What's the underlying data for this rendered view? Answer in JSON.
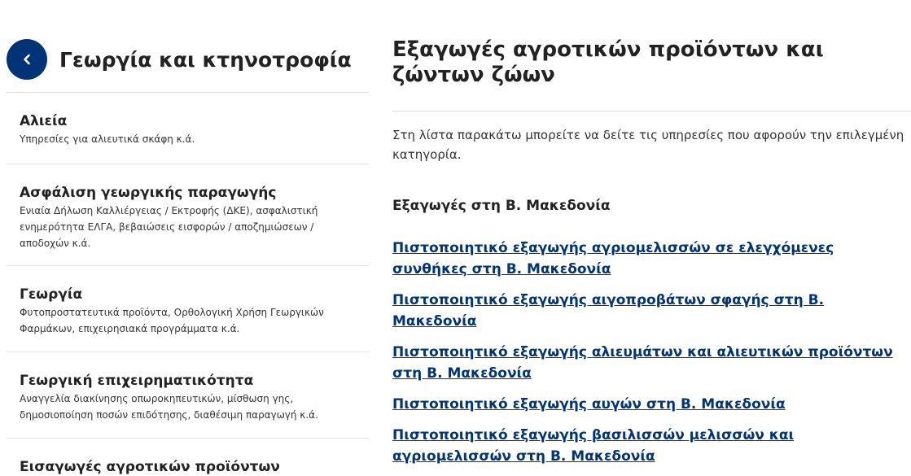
{
  "sidebar": {
    "back_icon": "chevron-left-icon",
    "title": "Γεωργία και κτηνοτροφία",
    "items": [
      {
        "title": "Αλιεία",
        "description": "Υπηρεσίες για αλιευτικά σκάφη κ.ά."
      },
      {
        "title": "Ασφάλιση γεωργικής παραγωγής",
        "description": "Ενιαία Δήλωση Καλλιέργειας / Εκτροφής (ΔΚΕ), ασφαλιστική ενημερότητα ΕΛΓΑ, βεβαιώσεις εισφορών / αποζημιώσεων / αποδοχών κ.ά."
      },
      {
        "title": "Γεωργία",
        "description": "Φυτοπροστατευτικά προϊόντα, Ορθολογική Χρήση Γεωργικών Φαρμάκων, επιχειρησιακά προγράμματα κ.ά."
      },
      {
        "title": "Γεωργική επιχειρηματικότητα",
        "description": "Αναγγελία διακίνησης οπωροκηπευτικών, μίσθωση γης, δημοσιοποίηση ποσών επιδότησης, διαθέσιμη παραγωγή κ.ά."
      },
      {
        "title": "Εισαγωγές αγροτικών προϊόντων",
        "description": ""
      }
    ]
  },
  "main": {
    "title": "Εξαγωγές αγροτικών προϊόντων και ζώντων ζώων",
    "intro": "Στη λίστα παρακάτω μπορείτε να δείτε τις υπηρεσίες που αφορούν την επιλεγμένη κατηγορία.",
    "section_heading": "Εξαγωγές στη Β. Μακεδονία",
    "links": [
      "Πιστοποιητικό εξαγωγής αγριομελισσών σε ελεγχόμενες συνθήκες στη Β. Μακεδονία",
      "Πιστοποιητικό εξαγωγής αιγοπροβάτων σφαγής στη Β. Μακεδονία",
      "Πιστοποιητικό εξαγωγής αλιευμάτων και αλιευτικών προϊόντων στη Β. Μακεδονία",
      "Πιστοποιητικό εξαγωγής αυγών στη Β. Μακεδονία",
      "Πιστοποιητικό εξαγωγής βασιλισσών μελισσών και αγριομελισσών στη Β. Μακεδονία"
    ]
  },
  "colors": {
    "brand": "#003476",
    "text": "#222222",
    "divider": "#dddddd"
  }
}
